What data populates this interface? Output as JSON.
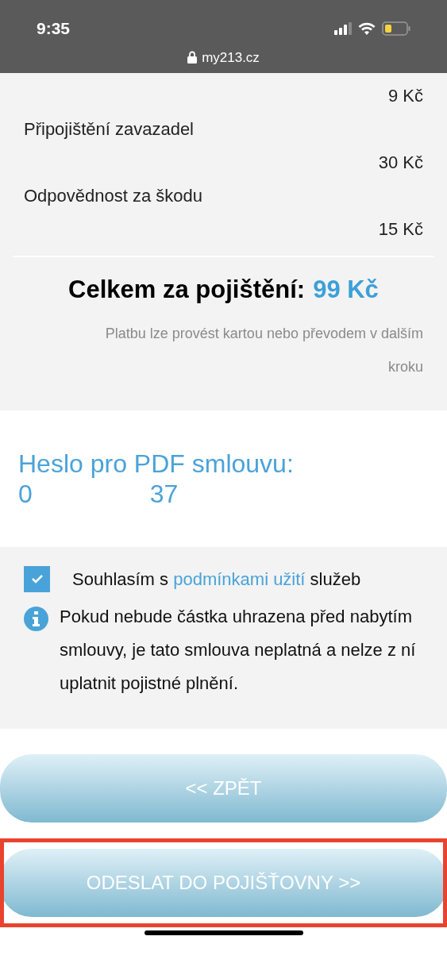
{
  "status_bar": {
    "time": "9:35",
    "url": "my213.cz"
  },
  "items": [
    {
      "price": "9 Kč"
    },
    {
      "label": "Připojištění zavazadel",
      "price": "30 Kč"
    },
    {
      "label": "Odpovědnost za škodu",
      "price": "15 Kč"
    }
  ],
  "total": {
    "label": "Celkem za pojištění:",
    "value": "99 Kč"
  },
  "payment_note": "Platbu lze provést kartou nebo převodem v dalším kroku",
  "password": {
    "label": "Heslo pro PDF smlouvu:",
    "start": "0",
    "end": "37"
  },
  "consent": {
    "checked": true,
    "before": "Souhlasím s",
    "link": "podmínkami užití",
    "after": "služeb"
  },
  "info": "Pokud nebude částka uhrazena před nabytím smlouvy, je tato smlouva neplatná a nelze z ní uplatnit pojistné plnění.",
  "buttons": [
    {
      "label": "<< ZPĚT",
      "highlighted": false
    },
    {
      "label": "ODESLAT DO POJIŠŤOVNY >>",
      "highlighted": true
    }
  ]
}
